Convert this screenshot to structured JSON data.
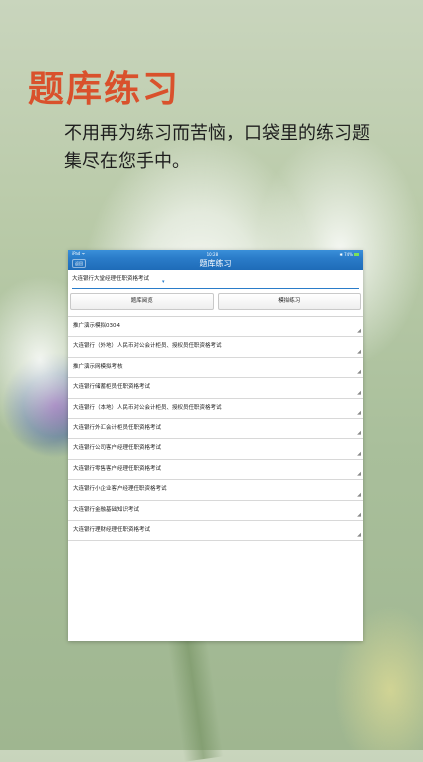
{
  "promo": {
    "headline": "题库练习",
    "subtitle": "不用再为练习而苦恼，口袋里的练习题集尽在您手中。"
  },
  "device": {
    "status_left": "iPad ᯤ",
    "status_time": "10:28",
    "status_right": "74%",
    "nav_back": "返回",
    "nav_title": "题库练习"
  },
  "selector": {
    "value": "大连银行大堂经理任职资格考试",
    "icon": "chevron-down-icon"
  },
  "buttons": {
    "browse": "题库阅览",
    "practice": "模拟练习"
  },
  "items": [
    "推广演示模拟0304",
    "大连银行（外地）人民币对公会计柜员、授权员任职资格考试",
    "推广演示网模拟考核",
    "大连银行储蓄柜员任职资格考试",
    "大连银行（本地）人民币对公会计柜员、授权员任职资格考试",
    "大连银行外汇会计柜员任职资格考试",
    "大连银行公司客户经理任职资格考试",
    "大连银行零售客户经理任职资格考试",
    "大连银行小企业客户经理任职资格考试",
    "大连银行金融基础知识考试",
    "大连银行理财经理任职资格考试"
  ],
  "colors": {
    "headline": "#d9512c",
    "nav_bar": "#2a7cc9"
  }
}
